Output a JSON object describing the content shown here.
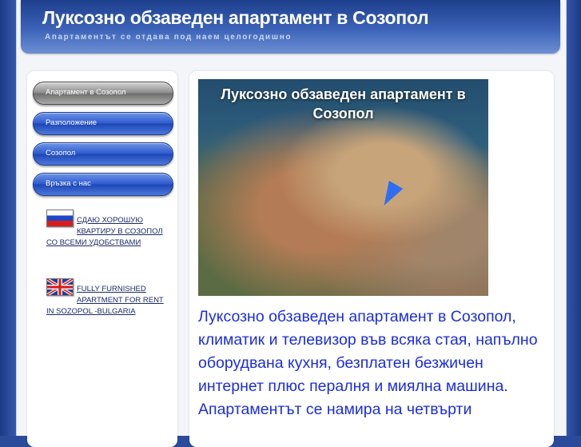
{
  "header": {
    "title": "Луксозно обзаведен апартамент в Созопол",
    "subtitle": "Апартаментът се отдава под наем целогодишно"
  },
  "nav": {
    "items": [
      {
        "label": "Апартамент в Созопол",
        "active": true
      },
      {
        "label": "Разположение",
        "active": false
      },
      {
        "label": "Созопол",
        "active": false
      },
      {
        "label": "Връзка с нас",
        "active": false
      }
    ]
  },
  "languages": {
    "ru": {
      "text": "СДАЮ ХОРОШУЮ КВАРТИРУ В СОЗОПОЛ СО ВСЕМИ УДОБСТВАМИ",
      "flag": "russia-flag-icon"
    },
    "en": {
      "text": "FULLY FURNISHED APARTMENT FOR RENT IN SOZOPOL -BULGARIA",
      "flag": "uk-flag-icon"
    }
  },
  "main": {
    "photo_title": "Луксозно обзаведен апартамент в Созопол",
    "description": "Луксозно обзаведен апартамент в Созопол, климатик и телевизор във всяка стая, напълно оборудвана кухня, безплатен безжичен интернет плюс пералня и миялна машина. Апартаментът се намира на четвърти"
  },
  "colors": {
    "header_blue": "#3c63b8",
    "link_text": "#1a2b6a",
    "description_text": "#1c2ed8",
    "nav_blue": "#2e5bd0",
    "nav_active_gray": "#8d8d8d"
  }
}
